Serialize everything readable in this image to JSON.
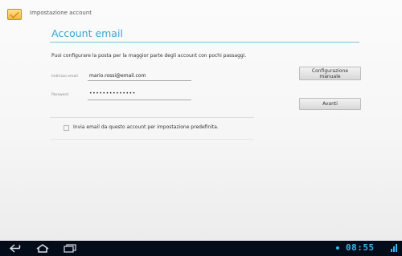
{
  "app": {
    "title": "Impostazione account",
    "icon": "email-app-icon"
  },
  "page": {
    "header": "Account email",
    "intro": "Puoi configurare la posta per la maggior parte degli account con pochi passaggi."
  },
  "form": {
    "email_label": "Indirizzo email",
    "email_value": "mario.rossi@email.com",
    "password_label": "Password",
    "password_value": "••••••••••••••"
  },
  "buttons": {
    "manual_line1": "Configurazione",
    "manual_line2": "manuale",
    "next": "Avanti"
  },
  "options": {
    "default_label": "Invia email da questo account per impostazione predefinita.",
    "default_checked": false
  },
  "statusbar": {
    "clock": "08:55",
    "icons": [
      "back-icon",
      "home-icon",
      "recent-apps-icon",
      "status-icon",
      "signal-icon"
    ]
  },
  "colors": {
    "accent": "#3aa6d0",
    "nav_bg": "#050c19",
    "clock": "#39b7ec"
  }
}
